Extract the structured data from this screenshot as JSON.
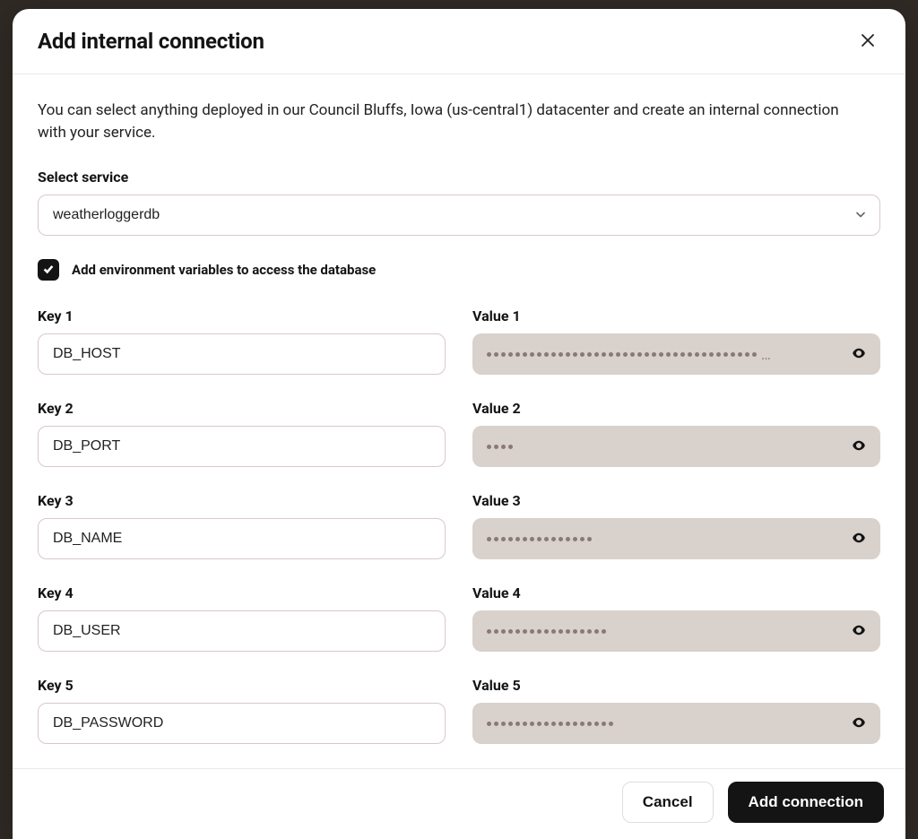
{
  "modal": {
    "title": "Add internal connection",
    "intro": "You can select anything deployed in our Council Bluffs, Iowa (us-central1) datacenter and create an internal connection with your service.",
    "select_service_label": "Select service",
    "selected_service": "weatherloggerdb",
    "checkbox_label": "Add environment variables to access the database",
    "checkbox_checked": true,
    "env_rows": [
      {
        "key_label": "Key 1",
        "key": "DB_HOST",
        "value_label": "Value 1",
        "value_mask_dots": 38,
        "value_truncated": true
      },
      {
        "key_label": "Key 2",
        "key": "DB_PORT",
        "value_label": "Value 2",
        "value_mask_dots": 4,
        "value_truncated": false
      },
      {
        "key_label": "Key 3",
        "key": "DB_NAME",
        "value_label": "Value 3",
        "value_mask_dots": 15,
        "value_truncated": false
      },
      {
        "key_label": "Key 4",
        "key": "DB_USER",
        "value_label": "Value 4",
        "value_mask_dots": 17,
        "value_truncated": false
      },
      {
        "key_label": "Key 5",
        "key": "DB_PASSWORD",
        "value_label": "Value 5",
        "value_mask_dots": 18,
        "value_truncated": false
      }
    ],
    "footer": {
      "cancel": "Cancel",
      "submit": "Add connection"
    }
  }
}
